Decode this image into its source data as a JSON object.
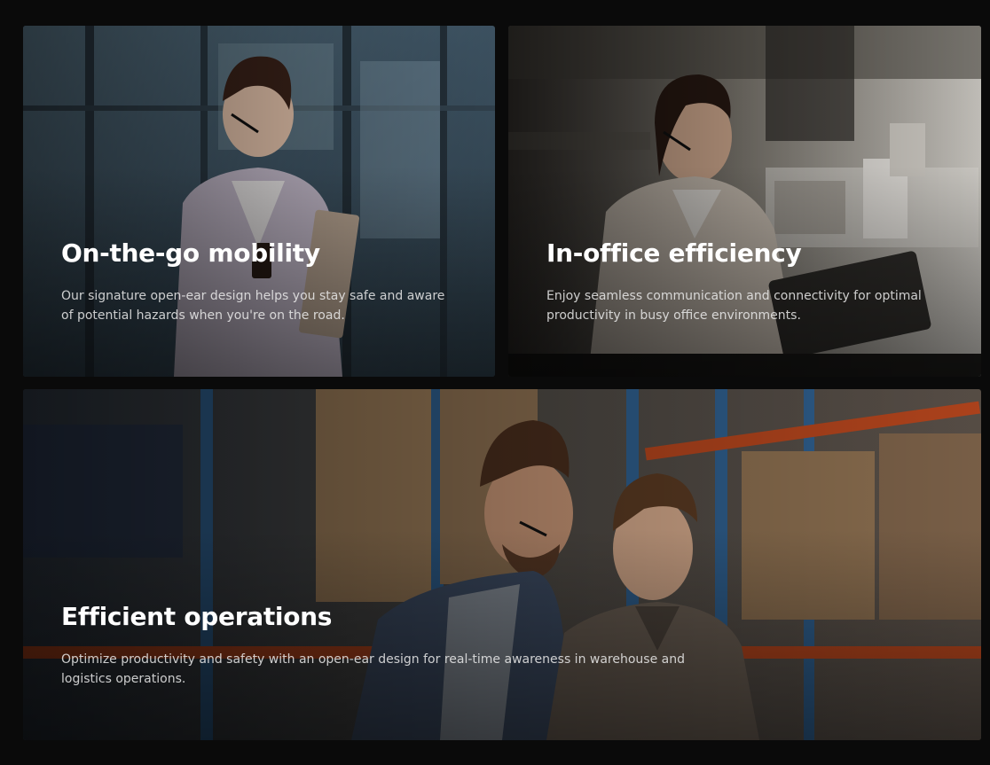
{
  "cards": [
    {
      "title": "On-the-go mobility",
      "description": "Our signature open-ear design helps you stay safe and aware of potential hazards when you're on the road."
    },
    {
      "title": "In-office efficiency",
      "description": "Enjoy seamless communication and connectivity for optimal productivity in busy office environments."
    },
    {
      "title": "Efficient operations",
      "description": "Optimize productivity and safety with an open-ear design for real-time awareness in warehouse and logistics operations."
    }
  ],
  "colors": {
    "page_background": "#0a0a0a",
    "title_text": "#ffffff",
    "body_text": "#e0e0e0"
  }
}
